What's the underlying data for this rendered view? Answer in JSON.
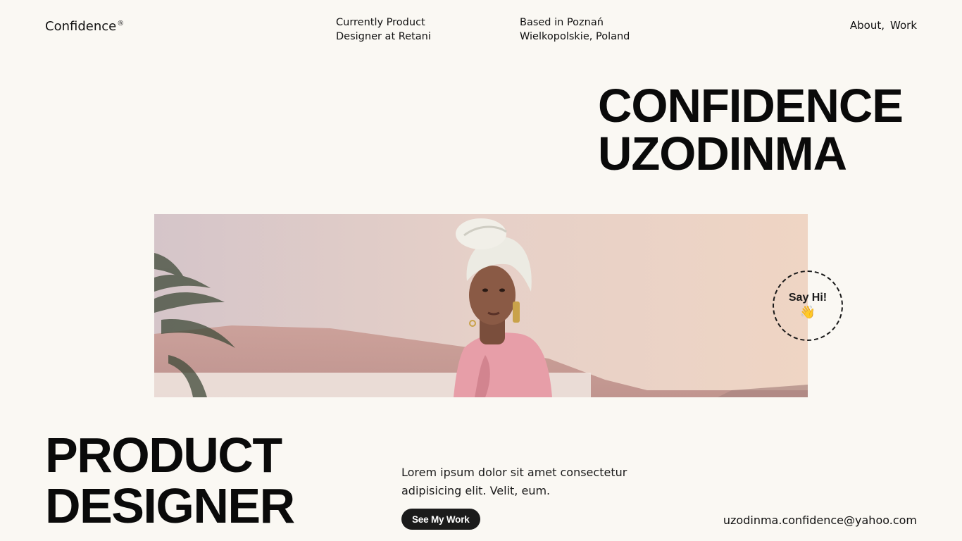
{
  "header": {
    "logo_text": "Confidence",
    "logo_mark": "®",
    "role_line1": "Currently Product",
    "role_line2": "Designer at Retani",
    "location_line1": "Based in Poznań",
    "location_line2": "Wielkopolskie, Poland",
    "nav": [
      {
        "label": "About,"
      },
      {
        "label": "Work"
      }
    ]
  },
  "hero": {
    "name_line1": "CONFIDENCE",
    "name_line2": "UZODINMA"
  },
  "badge": {
    "label": "Say Hi!",
    "emoji": "👋",
    "icon": "waving-hand-icon"
  },
  "bottom": {
    "title_line1": "PRODUCT",
    "title_line2": "DESIGNER",
    "intro": "Lorem ipsum dolor sit amet consectetur adipisicing elit. Velit, eum.",
    "cta_label": "See My Work",
    "email": "uzodinma.confidence@yahoo.com"
  },
  "colors": {
    "background": "#faf8f3",
    "text": "#111111",
    "button": "#1b1b1b"
  }
}
